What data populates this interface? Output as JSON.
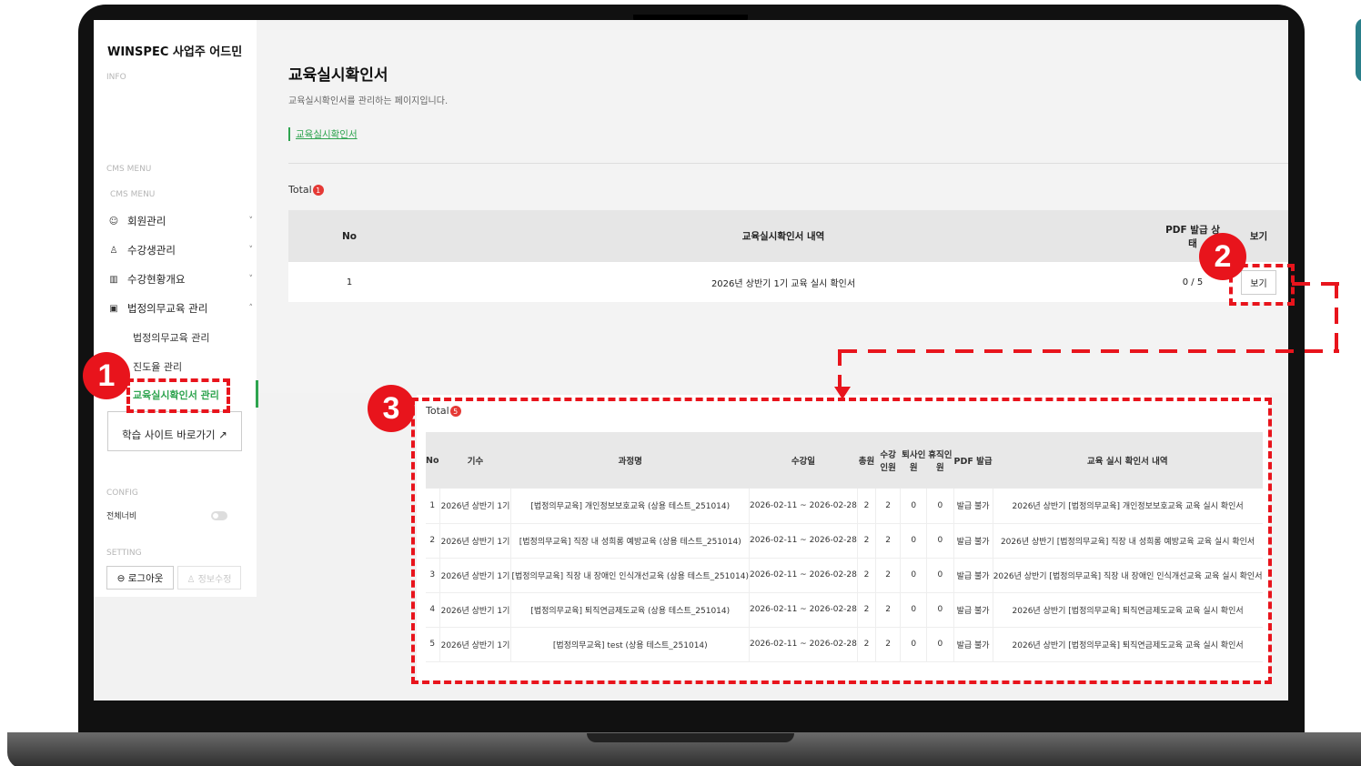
{
  "sidebar": {
    "title": "WINSPEC 사업주 어드민",
    "info_label": "INFO",
    "cms_menu_label": "CMS MENU",
    "cms_menu_label2": "CMS MENU",
    "menu": [
      {
        "label": "회원관리",
        "icon": "smile-icon",
        "chevron": "˅"
      },
      {
        "label": "수강생관리",
        "icon": "person-icon",
        "chevron": "˅"
      },
      {
        "label": "수강현황개요",
        "icon": "chart-icon",
        "chevron": "˅"
      },
      {
        "label": "법정의무교육 관리",
        "icon": "book-icon",
        "chevron": "˄"
      }
    ],
    "submenu": [
      "법정의무교육 관리",
      "진도율 관리"
    ],
    "active_submenu": "교육실시확인서 관리",
    "site_button": "학습 사이트 바로가기 ↗",
    "config_label": "CONFIG",
    "wide_label": "전체너비",
    "setting_label": "SETTING",
    "logout": "⊖ 로그아웃",
    "edit_info": "♙ 정보수정"
  },
  "main": {
    "title": "교육실시확인서",
    "description": "교육실시확인서를 관리하는 페이지입니다.",
    "breadcrumb": "교육실시확인서",
    "total_label": "Total",
    "total_count": "1",
    "table": {
      "headers": [
        "No",
        "교육실시확인서 내역",
        "PDF 발급 상태",
        "보기"
      ],
      "rows": [
        [
          "1",
          "2026년 상반기 1기 교육 실시 확인서",
          "0 / 5",
          "보기"
        ]
      ]
    }
  },
  "popup": {
    "total_label": "Total",
    "total_count": "5",
    "headers": [
      "No",
      "기수",
      "과정명",
      "수강일",
      "총원",
      "수강인원",
      "퇴사인원",
      "휴직인원",
      "PDF 발급",
      "교육 실시 확인서 내역"
    ],
    "rows": [
      [
        "1",
        "2026년 상반기 1기",
        "[법정의무교육] 개인정보보호교육 (상용 테스트_251014)",
        "2026-02-11 ~ 2026-02-28",
        "2",
        "2",
        "0",
        "0",
        "발급 불가",
        "2026년 상반기 [법정의무교육] 개인정보보호교육 교육 실시 확인서"
      ],
      [
        "2",
        "2026년 상반기 1기",
        "[법정의무교육] 직장 내 성희롱 예방교육 (상용 테스트_251014)",
        "2026-02-11 ~ 2026-02-28",
        "2",
        "2",
        "0",
        "0",
        "발급 불가",
        "2026년 상반기 [법정의무교육] 직장 내 성희롱 예방교육 교육 실시 확인서"
      ],
      [
        "3",
        "2026년 상반기 1기",
        "[법정의무교육] 직장 내 장애인 인식개선교육 (상용 테스트_251014)",
        "2026-02-11 ~ 2026-02-28",
        "2",
        "2",
        "0",
        "0",
        "발급 불가",
        "2026년 상반기 [법정의무교육] 직장 내 장애인 인식개선교육 교육 실시 확인서"
      ],
      [
        "4",
        "2026년 상반기 1기",
        "[법정의무교육] 퇴직연금제도교육 (상용 테스트_251014)",
        "2026-02-11 ~ 2026-02-28",
        "2",
        "2",
        "0",
        "0",
        "발급 불가",
        "2026년 상반기 [법정의무교육] 퇴직연금제도교육 교육 실시 확인서"
      ],
      [
        "5",
        "2026년 상반기 1기",
        "[법정의무교육] test (상용 테스트_251014)",
        "2026-02-11 ~ 2026-02-28",
        "2",
        "2",
        "0",
        "0",
        "발급 불가",
        "2026년 상반기 [법정의무교육] 퇴직연금제도교육 교육 실시 확인서"
      ]
    ]
  },
  "annotations": {
    "step1": "1",
    "step2": "2",
    "step3": "3"
  },
  "colors": {
    "accent": "#2ea44f",
    "annotation": "#e8141c",
    "badge": "#e53935"
  }
}
